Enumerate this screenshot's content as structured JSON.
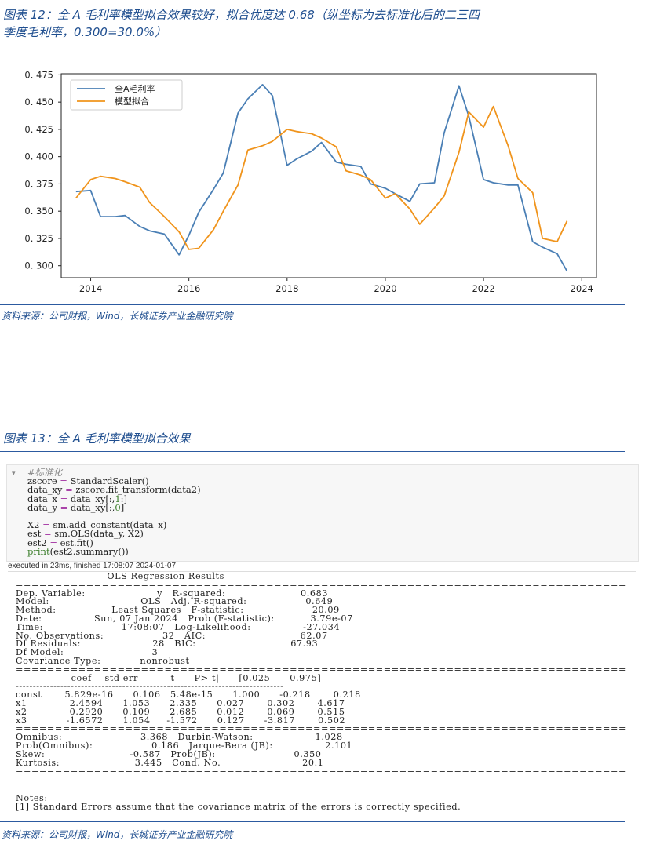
{
  "figure12": {
    "title_line1": "图表 12：全 A 毛利率模型拟合效果较好，拟合优度达 0.68（纵坐标为去标准化后的二三四",
    "title_line2": "季度毛利率，0.300=30.0%）",
    "source": "资料来源：公司财报，Wind，长城证券产业金融研究院"
  },
  "chart_data": {
    "type": "line",
    "x": [
      2013.7,
      2014.0,
      2014.2,
      2014.5,
      2014.7,
      2015.0,
      2015.2,
      2015.5,
      2015.8,
      2016.0,
      2016.2,
      2016.5,
      2016.7,
      2017.0,
      2017.2,
      2017.5,
      2017.7,
      2018.0,
      2018.2,
      2018.5,
      2018.7,
      2019.0,
      2019.2,
      2019.5,
      2019.7,
      2020.0,
      2020.2,
      2020.5,
      2020.7,
      2021.0,
      2021.2,
      2021.5,
      2021.7,
      2022.0,
      2022.2,
      2022.5,
      2022.7,
      2023.0,
      2023.2,
      2023.5,
      2023.7
    ],
    "series": [
      {
        "name": "全A毛利率",
        "color": "#4a7fb5",
        "values": [
          0.368,
          0.369,
          0.345,
          0.345,
          0.346,
          0.336,
          0.332,
          0.329,
          0.31,
          0.328,
          0.349,
          0.37,
          0.385,
          0.44,
          0.453,
          0.466,
          0.456,
          0.392,
          0.398,
          0.405,
          0.413,
          0.395,
          0.393,
          0.391,
          0.375,
          0.371,
          0.366,
          0.359,
          0.375,
          0.376,
          0.422,
          0.465,
          0.437,
          0.379,
          0.376,
          0.374,
          0.374,
          0.322,
          0.317,
          0.311,
          0.295
        ]
      },
      {
        "name": "模型拟合",
        "color": "#f0941c",
        "values": [
          0.362,
          0.379,
          0.382,
          0.38,
          0.377,
          0.372,
          0.358,
          0.345,
          0.331,
          0.315,
          0.316,
          0.333,
          0.35,
          0.374,
          0.406,
          0.41,
          0.414,
          0.425,
          0.423,
          0.421,
          0.417,
          0.409,
          0.387,
          0.383,
          0.379,
          0.362,
          0.366,
          0.352,
          0.338,
          0.353,
          0.364,
          0.404,
          0.441,
          0.427,
          0.446,
          0.41,
          0.38,
          0.367,
          0.325,
          0.322,
          0.341
        ]
      }
    ],
    "xlim": [
      2013.4,
      2024.3
    ],
    "ylim": [
      0.289,
      0.476
    ],
    "yticks": [
      0.3,
      0.325,
      0.35,
      0.375,
      0.4,
      0.425,
      0.45,
      0.475
    ],
    "ytick_labels": [
      "0. 300",
      "0. 325",
      "0. 350",
      "0. 375",
      "0. 400",
      "0. 425",
      "0. 450",
      "0. 475"
    ],
    "xticks": [
      2014,
      2016,
      2018,
      2020,
      2022,
      2024
    ],
    "xtick_labels": [
      "2014",
      "2016",
      "2018",
      "2020",
      "2022",
      "2024"
    ],
    "grid": false,
    "legend_position": "top-left"
  },
  "figure13": {
    "title": "图表 13：全 A 毛利率模型拟合效果",
    "source": "资料来源：公司财报，Wind，长城证券产业金融研究院"
  },
  "code_cell": {
    "fold_icon": "chevron-down-icon",
    "comment": "#标准化",
    "lines": [
      "zscore = StandardScaler()",
      "data_xy = zscore.fit_transform(data2)",
      "data_x = data_xy[:,1:]",
      "data_y = data_xy[:,0]",
      "",
      "X2 = sm.add_constant(data_x)",
      "est = sm.OLS(data_y, X2)",
      "est2 = est.fit()",
      "print(est2.summary())"
    ],
    "exec_status": "executed in 23ms, finished 17:08:07 2024-01-07"
  },
  "ols_output": {
    "text": "                            OLS Regression Results\n==============================================================================\nDep. Variable:                      y   R-squared:                       0.683\nModel:                            OLS   Adj. R-squared:                  0.649\nMethod:                 Least Squares   F-statistic:                     20.09\nDate:                Sun, 07 Jan 2024   Prob (F-statistic):           3.79e-07\nTime:                        17:08:07   Log-Likelihood:                -27.034\nNo. Observations:                  32   AIC:                             62.07\nDf Residuals:                      28   BIC:                             67.93\nDf Model:                           3\nCovariance Type:            nonrobust\n==============================================================================\n                 coef    std err          t      P>|t|      [0.025      0.975]\n------------------------------------------------------------------------------\nconst       5.829e-16      0.106   5.48e-15      1.000      -0.218       0.218\nx1             2.4594      1.053      2.335      0.027       0.302       4.617\nx2             0.2920      0.109      2.685      0.012       0.069       0.515\nx3            -1.6572      1.054     -1.572      0.127      -3.817       0.502\n==============================================================================\nOmnibus:                        3.368   Durbin-Watson:                   1.028\nProb(Omnibus):                  0.186   Jarque-Bera (JB):                2.101\nSkew:                          -0.587   Prob(JB):                        0.350\nKurtosis:                       3.445   Cond. No.                         20.1\n==============================================================================",
    "notes": "Notes:\n[1] Standard Errors assume that the covariance matrix of the errors is correctly specified."
  }
}
